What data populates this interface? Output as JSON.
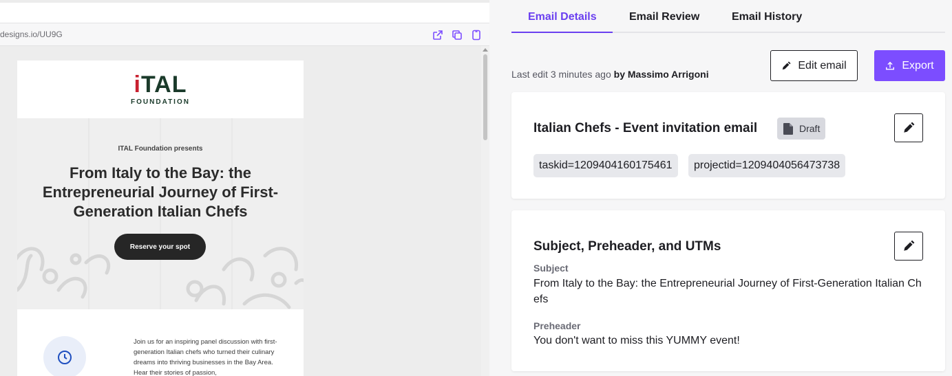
{
  "preview": {
    "url": "designs.io/UU9G",
    "url_icons": [
      "open-external-icon",
      "copy-icon",
      "mobile-icon"
    ],
    "email": {
      "logo_main_prefix": "i",
      "logo_main_rest": "TAL",
      "logo_sub": "FOUNDATION",
      "presents": "ITAL Foundation presents",
      "headline": "From Italy to the Bay: the Entrepreneurial Journey of First-Generation Italian Chefs",
      "cta_label": "Reserve your spot",
      "body_text": "Join us for an inspiring panel discussion with first-generation Italian chefs who turned their culinary dreams into thriving businesses in the Bay Area. Hear their stories of passion,"
    }
  },
  "tabs": [
    {
      "label": "Email Details",
      "active": true
    },
    {
      "label": "Email Review",
      "active": false
    },
    {
      "label": "Email History",
      "active": false
    }
  ],
  "meta": {
    "last_edit_prefix": "Last edit 3 minutes ago ",
    "last_edit_by": "by Massimo Arrigoni"
  },
  "actions": {
    "edit_label": "Edit email",
    "export_label": "Export"
  },
  "email_card": {
    "title": "Italian Chefs - Event invitation email",
    "status": "Draft",
    "tags": [
      "taskid=1209404160175461",
      "projectid=1209404056473738"
    ]
  },
  "subject_card": {
    "title": "Subject, Preheader, and UTMs",
    "subject_label": "Subject",
    "subject_value": "From Italy to the Bay: the Entrepreneurial Journey of First-Generation Italian Chefs",
    "preheader_label": "Preheader",
    "preheader_value": "You don't want to miss this YUMMY event!"
  },
  "colors": {
    "accent": "#6a3ff0",
    "export_button": "#7c4dff",
    "logo_green": "#1a3a2a",
    "logo_red": "#c8202f"
  }
}
